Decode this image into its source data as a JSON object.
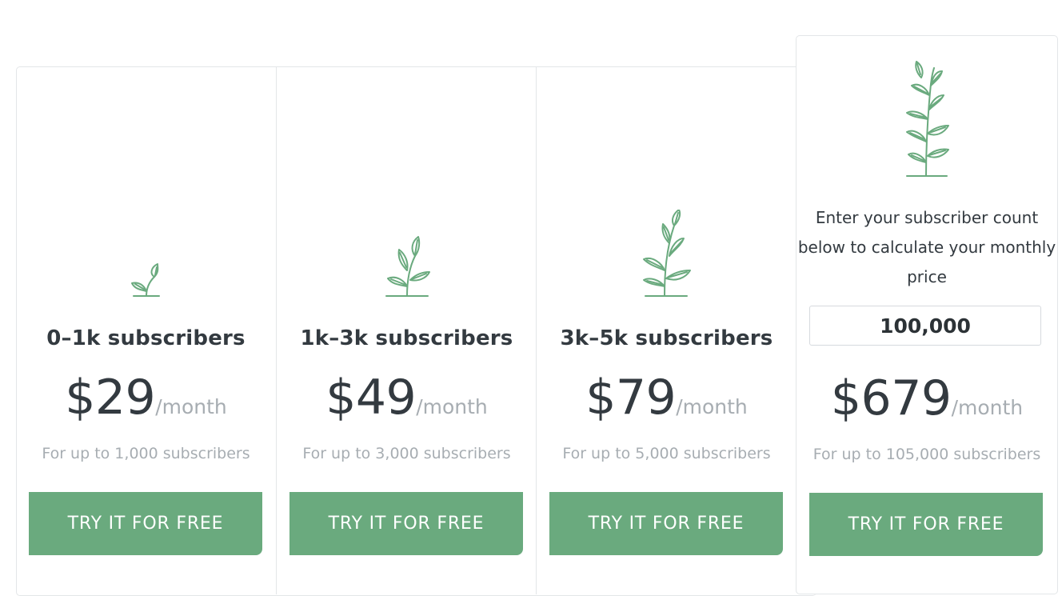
{
  "plans": [
    {
      "title": "0–1k subscribers",
      "price": "$29",
      "period": "/month",
      "note": "For up to 1,000 subscribers",
      "cta": "TRY IT FOR FREE",
      "icon": "sprout-icon"
    },
    {
      "title": "1k–3k subscribers",
      "price": "$49",
      "period": "/month",
      "note": "For up to 3,000 subscribers",
      "cta": "TRY IT FOR FREE",
      "icon": "small-plant-icon"
    },
    {
      "title": "3k–5k subscribers",
      "price": "$79",
      "period": "/month",
      "note": "For up to 5,000 subscribers",
      "cta": "TRY IT FOR FREE",
      "icon": "medium-plant-icon"
    }
  ],
  "custom": {
    "description": "Enter your subscriber count below to calculate your monthly price",
    "subscriber_count": "100,000",
    "price": "$679",
    "period": "/month",
    "note": "For up to 105,000 subscribers",
    "cta": "TRY IT FOR FREE",
    "icon": "tall-plant-icon"
  },
  "colors": {
    "accent": "#6aaa7e",
    "text": "#333a40",
    "muted": "#a7adb2",
    "border": "#e3e6e8"
  }
}
